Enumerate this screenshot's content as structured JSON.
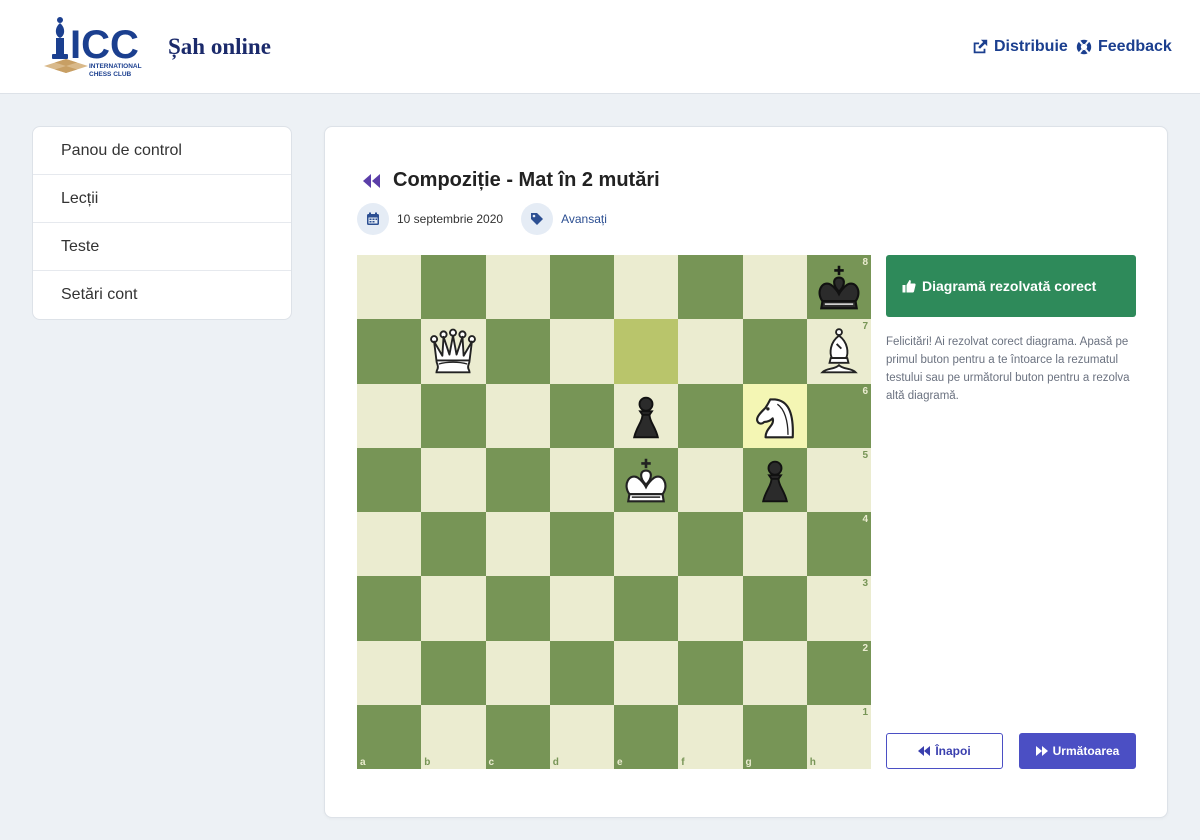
{
  "header": {
    "logo_text": "ICC",
    "logo_subtext_1": "INTERNATIONAL",
    "logo_subtext_2": "CHESS CLUB",
    "site_title": "Șah online",
    "share_label": "Distribuie",
    "feedback_label": "Feedback"
  },
  "sidebar": {
    "items": [
      {
        "label": "Panou de control"
      },
      {
        "label": "Lecții"
      },
      {
        "label": "Teste"
      },
      {
        "label": "Setări cont"
      }
    ]
  },
  "exercise": {
    "title": "Compoziție - Mat în 2 mutări",
    "date": "10 septembrie 2020",
    "level": "Avansați"
  },
  "board": {
    "files": [
      "a",
      "b",
      "c",
      "d",
      "e",
      "f",
      "g",
      "h"
    ],
    "ranks": [
      "8",
      "7",
      "6",
      "5",
      "4",
      "3",
      "2",
      "1"
    ],
    "pieces": [
      {
        "square": "h8",
        "piece": "black-king"
      },
      {
        "square": "b7",
        "piece": "white-queen"
      },
      {
        "square": "h7",
        "piece": "white-bishop"
      },
      {
        "square": "e6",
        "piece": "black-pawn"
      },
      {
        "square": "g6",
        "piece": "white-knight"
      },
      {
        "square": "e5",
        "piece": "white-king"
      },
      {
        "square": "g5",
        "piece": "black-pawn"
      }
    ],
    "last_move_from": "e7",
    "last_move_to": "g6"
  },
  "result": {
    "banner": "Diagramă rezolvată corect",
    "message": "Felicitări! Ai rezolvat corect diagrama. Apasă pe primul buton pentru a te întoarce la rezumatul testului sau pe următorul buton pentru a rezolva altă diagramă.",
    "prev_label": "Înapoi",
    "next_label": "Următoarea"
  },
  "colors": {
    "light_square": "#ebecd0",
    "dark_square": "#779556",
    "success": "#2e8a5a",
    "primary": "#4b4fc4",
    "brand": "#1b2a6b"
  }
}
